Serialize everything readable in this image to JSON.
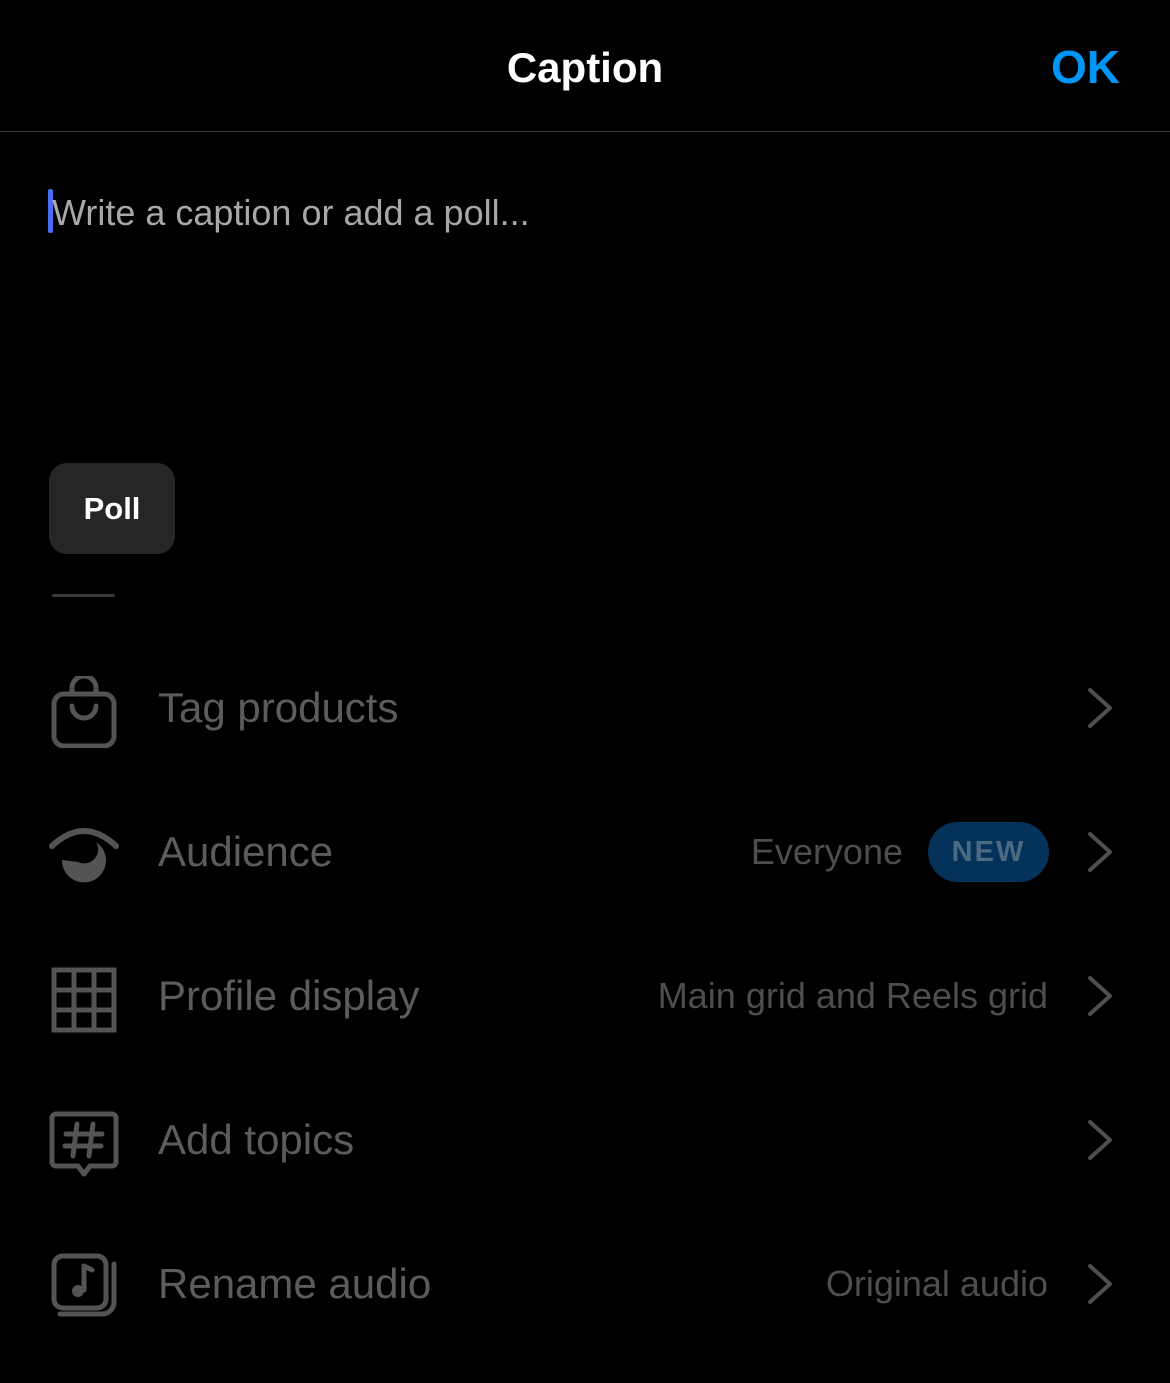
{
  "header": {
    "title": "Caption",
    "ok_label": "OK"
  },
  "caption": {
    "placeholder": "Write a caption or add a poll...",
    "value": ""
  },
  "poll_chip": {
    "label": "Poll"
  },
  "settings": {
    "tag_products": {
      "label": "Tag products",
      "icon": "shopping-bag-icon"
    },
    "audience": {
      "label": "Audience",
      "value": "Everyone",
      "badge": "NEW",
      "icon": "audience-eye-icon"
    },
    "profile_display": {
      "label": "Profile display",
      "value": "Main grid and Reels grid",
      "icon": "grid-icon"
    },
    "add_topics": {
      "label": "Add topics",
      "icon": "hashtag-icon"
    },
    "rename_audio": {
      "label": "Rename audio",
      "value": "Original audio",
      "icon": "music-note-icon"
    }
  },
  "colors": {
    "background": "#000000",
    "accent": "#0095f6",
    "dimmed_text": "#5c5c5c",
    "caret": "#4a6cf7",
    "badge_bg": "#05325a"
  }
}
